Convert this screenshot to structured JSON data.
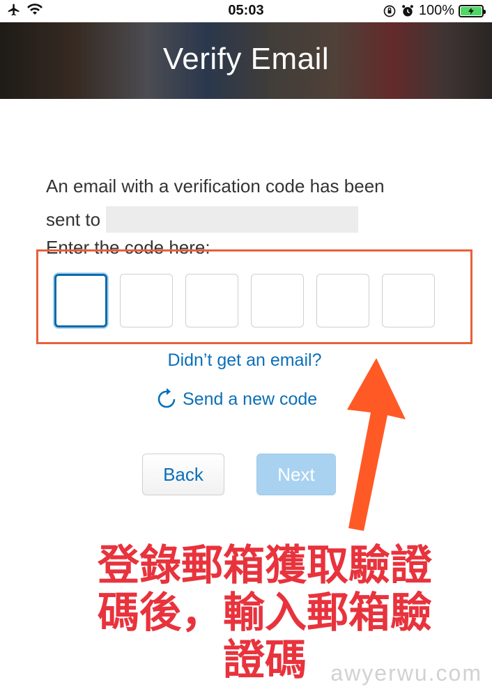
{
  "status_bar": {
    "time": "05:03",
    "battery": "100%",
    "icons": [
      "airplane-icon",
      "wifi-icon",
      "orientation-lock-icon",
      "alarm-icon",
      "battery-icon"
    ]
  },
  "header": {
    "title": "Verify Email"
  },
  "message": {
    "line1": "An email with a verification code has been",
    "line2_prefix": "sent to",
    "enter_label": "Enter the code here:"
  },
  "code_inputs": {
    "count": 6,
    "active_index": 0
  },
  "links": {
    "no_email": "Didn’t get an email?",
    "resend": "Send a new code"
  },
  "buttons": {
    "back": "Back",
    "next": "Next"
  },
  "annotation": {
    "caption_lines": [
      "登錄郵箱獲取驗證",
      "碼後，輸入郵箱驗",
      "證碼"
    ],
    "color": "#e8333d",
    "box_color": "#e8603a"
  },
  "watermark": "awyerwu.com",
  "colors": {
    "link": "#0b6fb8",
    "next_disabled": "#a8d2f0"
  }
}
